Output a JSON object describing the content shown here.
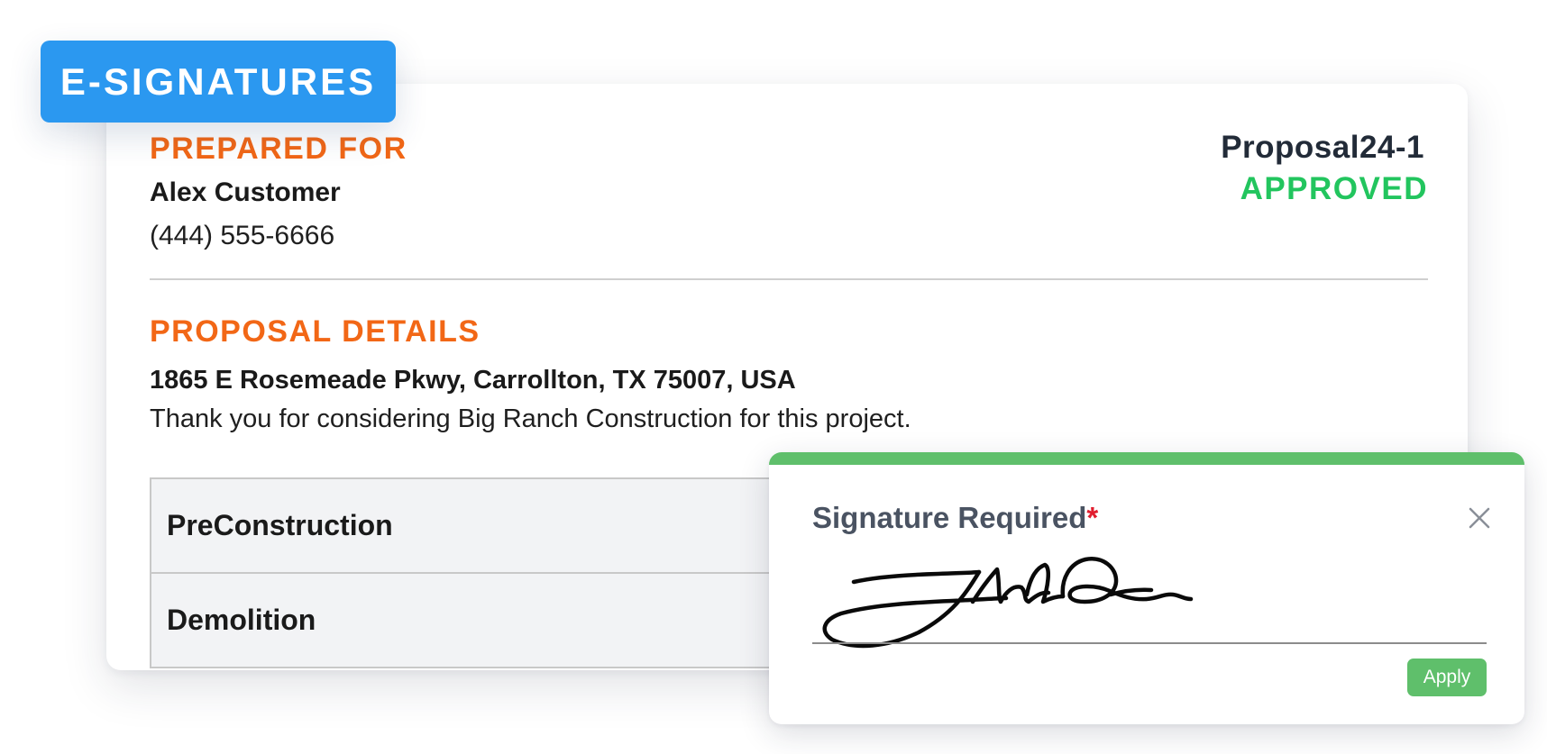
{
  "badge": {
    "label": "E-SIGNATURES"
  },
  "document": {
    "prepared_for": {
      "heading": "PREPARED FOR",
      "name": "Alex Customer",
      "phone": "(444) 555-6666"
    },
    "proposal": {
      "id": "Proposal24-1",
      "status": "APPROVED"
    },
    "details": {
      "heading": "PROPOSAL DETAILS",
      "address": "1865 E Rosemeade Pkwy, Carrollton, TX 75007, USA",
      "intro": "Thank you for considering Big Ranch Construction for this project."
    },
    "line_items": [
      {
        "label": "PreConstruction"
      },
      {
        "label": "Demolition"
      }
    ]
  },
  "signature_modal": {
    "title": "Signature Required",
    "required_mark": "*",
    "apply_label": "Apply"
  },
  "colors": {
    "accent_orange": "#f26716",
    "status_green": "#22c55e",
    "modal_green": "#5fbf6b",
    "badge_blue": "#2b98f0",
    "required_red": "#e11d2e"
  },
  "icons": {
    "close": "close-icon"
  }
}
